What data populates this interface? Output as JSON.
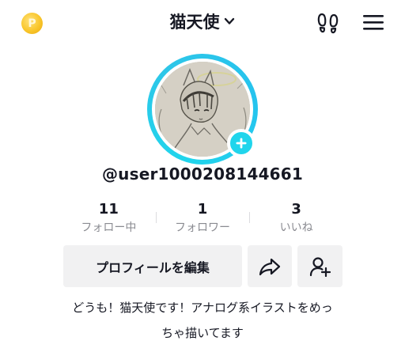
{
  "header": {
    "coin_glyph": "P",
    "title": "猫天使",
    "icons": [
      "coin-icon",
      "chevron-down-icon",
      "footprint-icon",
      "menu-icon"
    ]
  },
  "profile": {
    "username": "@user1000208144661",
    "avatar_alt": "avatar",
    "ring_color": "#20d5ec"
  },
  "stats": [
    {
      "value": "11",
      "label": "フォロー中"
    },
    {
      "value": "1",
      "label": "フォロワー"
    },
    {
      "value": "3",
      "label": "いいね"
    }
  ],
  "actions": {
    "edit_label": "プロフィールを編集",
    "share_icon": "share-icon",
    "add_user_icon": "add-user-icon"
  },
  "bio": {
    "line1": "どうも！猫天使です！アナログ系イラストをめっ",
    "line2": "ちゃ描いてます"
  },
  "colors": {
    "accent": "#20d5ec",
    "text": "#161823",
    "muted": "#8a8b91",
    "button_bg": "#f1f1f2"
  }
}
